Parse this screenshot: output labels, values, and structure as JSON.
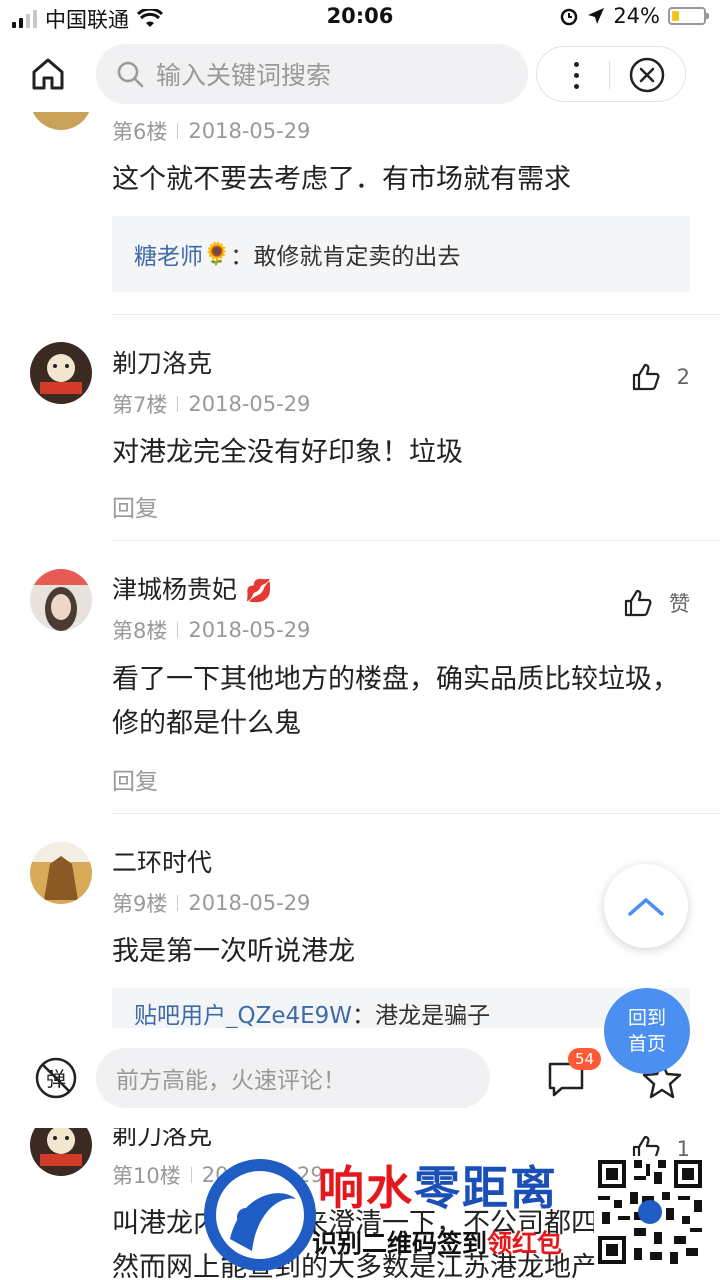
{
  "status": {
    "carrier": "中国联通",
    "time": "20:06",
    "battery": "24%",
    "battery_level": 0.24
  },
  "nav": {
    "search_placeholder": "输入关键词搜索"
  },
  "comments": [
    {
      "floor": "第6楼",
      "date": "2018-05-29",
      "text": "这个就不要去考虑了．有市场就有需求",
      "quote_user": "糖老师",
      "quote_sep": "：",
      "quote_text": "敢修就肯定卖的出去"
    },
    {
      "user": "剃刀洛克",
      "floor": "第7楼",
      "date": "2018-05-29",
      "text": "对港龙完全没有好印象！垃圾",
      "reply": "回复",
      "likes": "2"
    },
    {
      "user": "津城杨贵妃",
      "floor": "第8楼",
      "date": "2018-05-29",
      "text": "看了一下其他地方的楼盘，确实品质比较垃圾，修的都是什么鬼",
      "reply": "回复",
      "likes": "赞"
    },
    {
      "user": "二环时代",
      "floor": "第9楼",
      "date": "2018-05-29",
      "text": "我是第一次听说港龙",
      "quote_user": "贴吧用户_QZe4E9W",
      "quote_sep": "：",
      "quote_text": "港龙是骗子"
    },
    {
      "user": "剃刀洛克",
      "floor": "第10楼",
      "date": "2018-05-29",
      "text": "叫港龙内部人出来澄清一下，不公司都四?",
      "text2": "然而网上能查到的大多数是江苏港龙地产",
      "likes": "1"
    }
  ],
  "bottom": {
    "comment_placeholder": "前方高能，火速评论！",
    "comment_count": "54"
  },
  "float": {
    "back_home": "回到首页"
  },
  "watermark": {
    "title_part1": "响水",
    "title_part2": "零距离",
    "sub_part1": "识别二维码签到",
    "sub_part2": "领红包"
  }
}
